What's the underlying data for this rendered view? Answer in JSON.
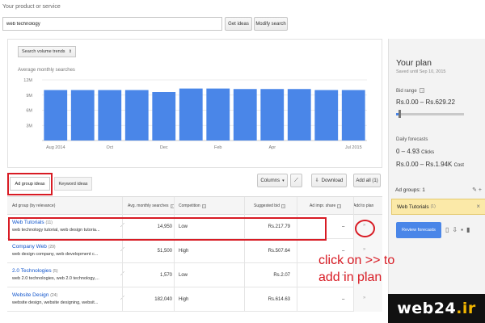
{
  "search": {
    "label": "Your product or service",
    "value": "web technology",
    "get_ideas": "Get ideas",
    "modify": "Modify search"
  },
  "chart_panel": {
    "trend_select": "Search volume trends",
    "title": "Average monthly searches"
  },
  "chart_data": {
    "type": "bar",
    "title": "Average monthly searches",
    "xlabel": "",
    "ylabel": "",
    "yticks": [
      "3M",
      "6M",
      "9M",
      "12M"
    ],
    "ylim": [
      0,
      12
    ],
    "categories": [
      "Aug 2014",
      "Sep 2014",
      "Oct 2014",
      "Nov 2014",
      "Dec 2014",
      "Jan 2015",
      "Feb 2015",
      "Mar 2015",
      "Apr 2015",
      "May 2015",
      "Jun 2015",
      "Jul 2015"
    ],
    "xtick_labels": [
      "Aug 2014",
      "",
      "Oct",
      "",
      "Dec",
      "",
      "Feb",
      "",
      "Apr",
      "",
      "",
      "Jul 2015"
    ],
    "values": [
      10.0,
      10.0,
      10.0,
      10.0,
      9.6,
      10.3,
      10.3,
      10.2,
      10.2,
      10.2,
      10.0,
      10.0
    ],
    "bar_color": "#4a86e8",
    "grid": true
  },
  "plan": {
    "title": "Your plan",
    "saved": "Saved until Sep 10, 2015",
    "bid_label": "Bid range",
    "bid_value": "Rs.0.00 – Rs.629.22",
    "slider_level": 0.04,
    "forecast_label": "Daily forecasts",
    "clicks_value": "0 – 4.93",
    "clicks_unit": "Clicks",
    "cost_value": "Rs.0.00 – Rs.1.94K",
    "cost_unit": "Cost",
    "adgroups_label": "Ad groups: 1",
    "adgroup_name": "Web Tutorials",
    "adgroup_count": "(1)",
    "review_button": "Review forecasts"
  },
  "toolbar": {
    "columns": "Columns",
    "download": "Download",
    "add_all": "Add all (1)"
  },
  "tabs": {
    "ad_group_ideas": "Ad group ideas",
    "keyword_ideas": "Keyword ideas"
  },
  "table": {
    "headers": {
      "group": "Ad group (by relevance)",
      "searches": "Avg. monthly searches",
      "competition": "Competition",
      "bid": "Suggested bid",
      "share": "Ad impr. share",
      "add": "Add to plan"
    },
    "rows": [
      {
        "name": "Web Tutorials",
        "count": "(11)",
        "keywords": "web technology tutorial, web design tutoria...",
        "searches": "14,950",
        "competition": "Low",
        "bid": "Rs.217.79",
        "share": "–"
      },
      {
        "name": "Company Web",
        "count": "(29)",
        "keywords": "web design company, web development c...",
        "searches": "51,500",
        "competition": "High",
        "bid": "Rs.507.64",
        "share": "–"
      },
      {
        "name": "2.0 Technologies",
        "count": "(5)",
        "keywords": "web 2.0 technologies, web 2.0 technology,...",
        "searches": "1,570",
        "competition": "Low",
        "bid": "Rs.2.07",
        "share": "–"
      },
      {
        "name": "Website Design",
        "count": "(24)",
        "keywords": "website design, website designing, websit...",
        "searches": "182,040",
        "competition": "High",
        "bid": "Rs.614.63",
        "share": "–"
      }
    ]
  },
  "annotation": {
    "line1": "click on >> to",
    "line2": "add in plan"
  },
  "watermark": {
    "main": "web24",
    "suffix": ".ir"
  },
  "colors": {
    "accent": "#4a86e8",
    "highlight": "#d81b24",
    "link": "#1155cc",
    "plan_adgroup_bg": "#fbe9a8"
  }
}
